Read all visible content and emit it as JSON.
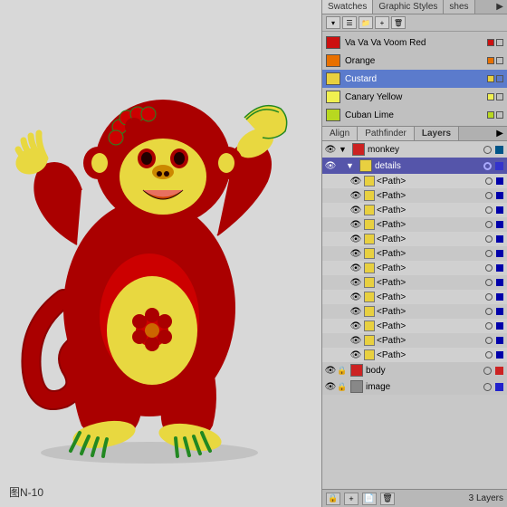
{
  "canvas": {
    "label": "图N-10",
    "background": "#d8d8d8"
  },
  "swatches_panel": {
    "tabs": [
      "Swatches",
      "Graphic Styles",
      "shes"
    ],
    "active_tab": "Swatches",
    "toolbar_buttons": [
      "grid",
      "list",
      "menu"
    ],
    "items": [
      {
        "id": "voom-red",
        "color": "#cc1111",
        "name": "Va Va Va Voom Red",
        "selected": false
      },
      {
        "id": "orange",
        "color": "#e87000",
        "name": "Orange",
        "selected": false
      },
      {
        "id": "custard",
        "color": "#e8d040",
        "name": "Custard",
        "selected": true
      },
      {
        "id": "canary-yellow",
        "color": "#f0f050",
        "name": "Canary Yellow",
        "selected": false
      },
      {
        "id": "cuban-lime",
        "color": "#b8d820",
        "name": "Cuban Lime",
        "selected": false
      }
    ]
  },
  "bottom_panel": {
    "tabs": [
      "Align",
      "Pathfinder",
      "Layers"
    ],
    "active_tab": "Layers",
    "layers": [
      {
        "id": "monkey",
        "name": "monkey",
        "type": "layer",
        "expanded": true,
        "has_eye": true,
        "color": "#cc2222"
      },
      {
        "id": "details",
        "name": "details",
        "type": "sublayer",
        "expanded": true,
        "selected": true,
        "has_eye": true,
        "color": "#3333cc"
      },
      {
        "id": "path1",
        "name": "<Path>",
        "type": "path",
        "has_eye": true,
        "color": "#e8d040"
      },
      {
        "id": "path2",
        "name": "<Path>",
        "type": "path",
        "has_eye": true,
        "color": "#e8d040"
      },
      {
        "id": "path3",
        "name": "<Path>",
        "type": "path",
        "has_eye": true,
        "color": "#e8d040"
      },
      {
        "id": "path4",
        "name": "<Path>",
        "type": "path",
        "has_eye": true,
        "color": "#e8d040"
      },
      {
        "id": "path5",
        "name": "<Path>",
        "type": "path",
        "has_eye": true,
        "color": "#e8d040"
      },
      {
        "id": "path6",
        "name": "<Path>",
        "type": "path",
        "has_eye": true,
        "color": "#e8d040"
      },
      {
        "id": "path7",
        "name": "<Path>",
        "type": "path",
        "has_eye": true,
        "color": "#e8d040"
      },
      {
        "id": "path8",
        "name": "<Path>",
        "type": "path",
        "has_eye": true,
        "color": "#e8d040"
      },
      {
        "id": "path9",
        "name": "<Path>",
        "type": "path",
        "has_eye": true,
        "color": "#e8d040"
      },
      {
        "id": "path10",
        "name": "<Path>",
        "type": "path",
        "has_eye": true,
        "color": "#e8d040"
      },
      {
        "id": "path11",
        "name": "<Path>",
        "type": "path",
        "has_eye": true,
        "color": "#e8d040"
      },
      {
        "id": "path12",
        "name": "<Path>",
        "type": "path",
        "has_eye": true,
        "color": "#e8d040"
      },
      {
        "id": "path13",
        "name": "<Path>",
        "type": "path",
        "has_eye": true,
        "color": "#e8d040"
      }
    ],
    "bottom_layers": [
      {
        "id": "body",
        "name": "body",
        "type": "layer",
        "has_eye": true,
        "color": "#cc2222"
      },
      {
        "id": "image",
        "name": "image",
        "type": "layer",
        "has_eye": true,
        "color": "#2222cc"
      }
    ],
    "layers_count": "3 Layers"
  }
}
